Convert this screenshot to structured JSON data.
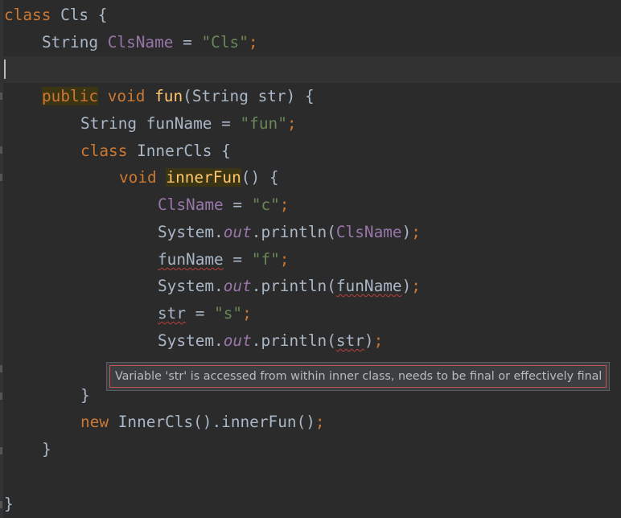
{
  "code": {
    "kw_class": "class",
    "kw_public": "public",
    "kw_void": "void",
    "kw_new": "new",
    "cls_name": "Cls",
    "type_string": "String",
    "field_clsname": "ClsName",
    "str_cls": "\"Cls\"",
    "fn_fun": "fun",
    "param_str": "str",
    "local_funname": "funName",
    "str_fun": "\"fun\"",
    "inner_cls": "InnerCls",
    "fn_innerfun": "innerFun",
    "str_c": "\"c\"",
    "system": "System",
    "out": "out",
    "println": "println",
    "str_f": "\"f\"",
    "str_s": "\"s\"",
    "open_brace": "{",
    "close_brace": "}"
  },
  "tooltip": {
    "message": "Variable 'str' is accessed from within inner class, needs to be final or effectively final"
  },
  "colors": {
    "background": "#2b2b2b",
    "keyword": "#cc7832",
    "string": "#6a8759",
    "field": "#9876aa",
    "function": "#ffc66d",
    "text": "#a9b7c6",
    "error_underline": "#bc3f3c",
    "tooltip_border": "#c75450"
  }
}
